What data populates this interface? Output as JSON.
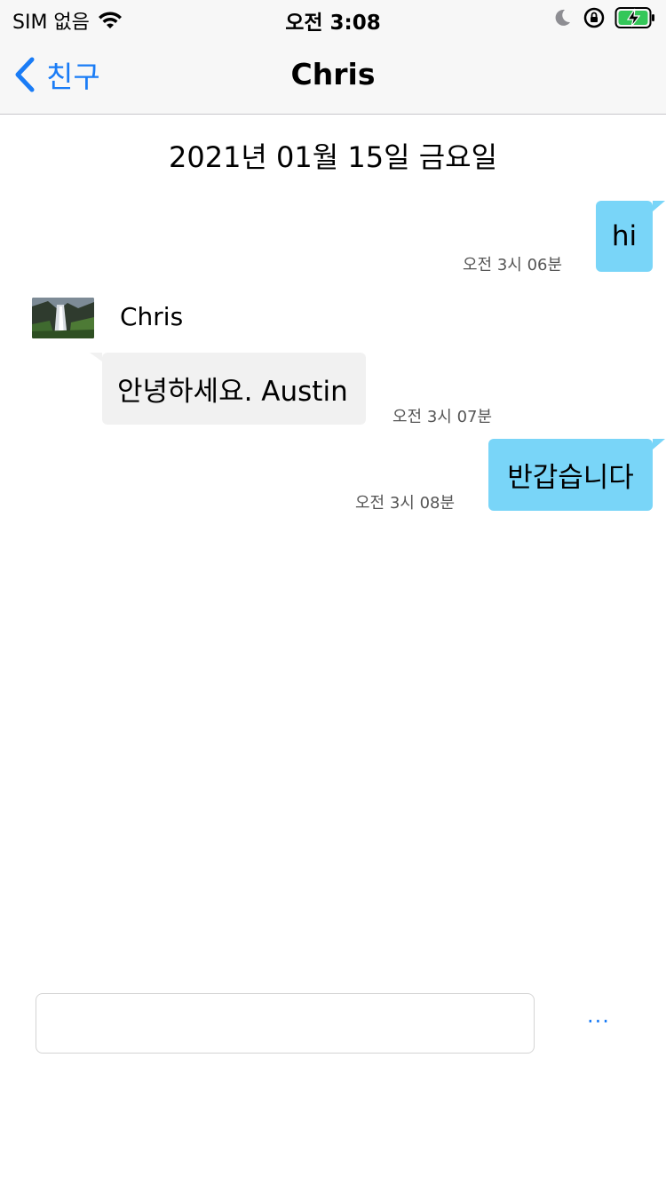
{
  "status_bar": {
    "carrier": "SIM 없음",
    "time": "오전 3:08"
  },
  "nav": {
    "back_label": "친구",
    "title": "Chris"
  },
  "chat": {
    "date_header": "2021년 01월 15일 금요일",
    "messages": [
      {
        "direction": "out",
        "text": "hi",
        "time": "오전 3시 06분"
      },
      {
        "direction": "in",
        "sender": "Chris",
        "text": "안녕하세요. Austin",
        "time": "오전 3시 07분"
      },
      {
        "direction": "out",
        "text": "반갑습니다",
        "time": "오전 3시 08분"
      }
    ]
  },
  "composer": {
    "input_value": "",
    "more_label": "···"
  },
  "colors": {
    "accent": "#1a7cf6",
    "outgoing_bubble": "#79d5f8",
    "incoming_bubble": "#f1f1f1"
  }
}
